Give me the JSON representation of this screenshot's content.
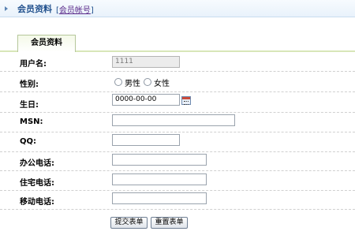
{
  "header": {
    "title": "会员资料",
    "link_open": "[",
    "link_label": "会员帐号",
    "link_close": "]"
  },
  "tab": {
    "label": "会员资料"
  },
  "form": {
    "username": {
      "label": "用户名:",
      "value": "1111"
    },
    "gender": {
      "label": "性别:",
      "option_male": "男性",
      "option_female": "女性"
    },
    "birthday": {
      "label": "生日:",
      "value": "0000-00-00"
    },
    "msn": {
      "label": "MSN:",
      "value": ""
    },
    "qq": {
      "label": "QQ:",
      "value": ""
    },
    "office_phone": {
      "label": "办公电话:",
      "value": ""
    },
    "home_phone": {
      "label": "住宅电话:",
      "value": ""
    },
    "mobile_phone": {
      "label": "移动电话:",
      "value": ""
    }
  },
  "buttons": {
    "submit": "提交表单",
    "reset": "重置表单"
  },
  "icons": {
    "header_marker": "triangle-right-icon",
    "date_picker": "calendar-icon"
  }
}
